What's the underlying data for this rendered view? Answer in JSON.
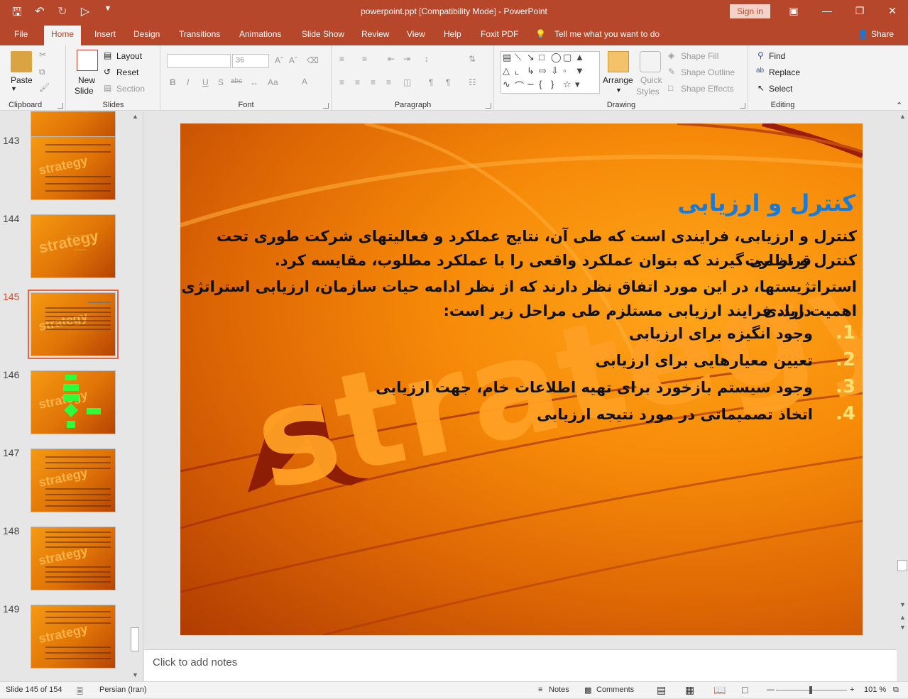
{
  "window": {
    "doc_title": "powerpoint.ppt [Compatibility Mode]  -  PowerPoint",
    "signin": "Sign in"
  },
  "tabs": [
    "File",
    "Home",
    "Insert",
    "Design",
    "Transitions",
    "Animations",
    "Slide Show",
    "Review",
    "View",
    "Help",
    "Foxit PDF",
    "Tell me what you want to do"
  ],
  "share": "Share",
  "ribbon": {
    "clipboard": {
      "paste": "Paste",
      "label": "Clipboard"
    },
    "slides": {
      "new_slide_1": "New",
      "new_slide_2": "Slide",
      "layout": "Layout",
      "reset": "Reset",
      "section": "Section",
      "label": "Slides"
    },
    "font": {
      "size": "36",
      "label": "Font"
    },
    "paragraph": {
      "label": "Paragraph"
    },
    "drawing": {
      "arrange": "Arrange",
      "quick_1": "Quick",
      "quick_2": "Styles",
      "shape_fill": "Shape Fill",
      "shape_outline": "Shape Outline",
      "shape_effects": "Shape Effects",
      "label": "Drawing"
    },
    "editing": {
      "find": "Find",
      "replace": "Replace",
      "select": "Select",
      "label": "Editing"
    }
  },
  "thumbnails": [
    {
      "num": "143"
    },
    {
      "num": "144"
    },
    {
      "num": "145"
    },
    {
      "num": "146"
    },
    {
      "num": "147"
    },
    {
      "num": "148"
    },
    {
      "num": "149"
    }
  ],
  "slide": {
    "bg_word": "strategy",
    "title": "کنترل و ارزیابی",
    "para1_line1": "کنترل و ارزیابی، فرایندی است که طی آن، نتایج عملکرد و فعالیتهای شرکت طوری تحت کنترل و نظارت",
    "para1_line2": "قرار می گیرند که بتوان عملکرد واقعی را با عملکرد مطلوب، مقایسه کرد.",
    "para2_line1": "استراتژیستها، در این مورد اتفاق نظر دارند که از نظر ادامه حیات سازمان، ارزیابی استراتژی اهمیت زیادی",
    "para2_line2": "دارد. فرایند ارزیابی مستلزم طی مراحل زیر است:",
    "items": [
      {
        "num": "1.",
        "text": "وجود انگیزه برای ارزیابی"
      },
      {
        "num": "2.",
        "text": "تعیین معیارهایی برای ارزیابی"
      },
      {
        "num": "3.",
        "text": "وجود سیستم بازخورد برای تهیه اطلاعات خام، جهت ارزیابی"
      },
      {
        "num": "4.",
        "text": "اتخاذ تصمیماتی در مورد نتیجه ارزیابی"
      }
    ]
  },
  "notes_placeholder": "Click to add notes",
  "status": {
    "slide_info": "Slide 145 of 154",
    "language": "Persian (Iran)",
    "notes": "Notes",
    "comments": "Comments",
    "zoom": "101 %"
  }
}
